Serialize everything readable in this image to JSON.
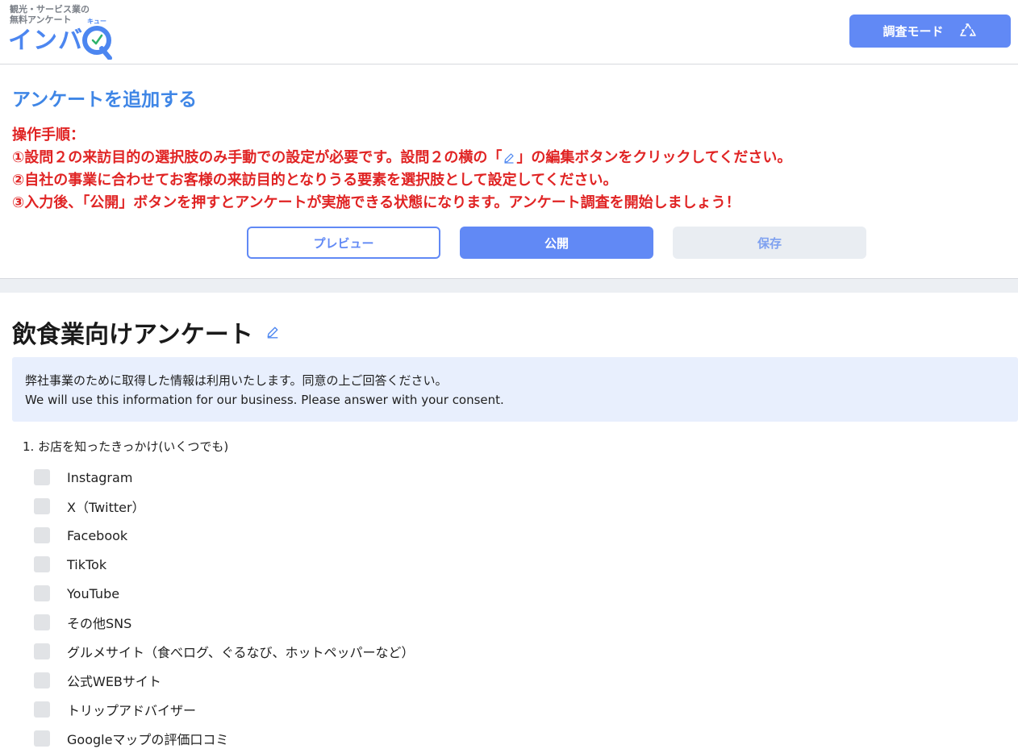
{
  "header": {
    "logo_tagline_line1": "観光・サービス業の",
    "logo_tagline_line2": "無料アンケート",
    "logo_brand": "インバ",
    "logo_q_ruby": "キュー",
    "mode_button_label": "調査モード"
  },
  "instructions": {
    "title": "アンケートを追加する",
    "heading": "操作手順：",
    "step1_before": "①設問２の来訪目的の選択肢のみ手動での設定が必要です。設問２の横の「",
    "step1_after": "」の編集ボタンをクリックしてください。",
    "step2": "②自社の事業に合わせてお客様の来訪目的となりうる要素を選択肢として設定してください。",
    "step3": "③入力後、「公開」ボタンを押すとアンケートが実施できる状態になります。アンケート調査を開始しましょう！"
  },
  "actions": {
    "preview_label": "プレビュー",
    "publish_label": "公開",
    "save_label": "保存"
  },
  "survey": {
    "title": "飲食業向けアンケート",
    "notice_line1": "弊社事業のために取得した情報は利用いたします。同意の上ご回答ください。",
    "notice_line2": "We will use this information for our business. Please answer with your consent.",
    "question1": {
      "label": "1. お店を知ったきっかけ(いくつでも)",
      "options": [
        "Instagram",
        "X（Twitter）",
        "Facebook",
        "TikTok",
        "YouTube",
        "その他SNS",
        "グルメサイト（食べログ、ぐるなび、ホットペッパーなど）",
        "公式WEBサイト",
        "トリップアドバイザー",
        "Googleマップの評価口コミ"
      ]
    }
  },
  "colors": {
    "accent": "#6189f5",
    "title_blue": "#3f86e6",
    "instruction_red": "#e02424",
    "notice_bg": "#e8effd"
  },
  "icons": {
    "mode_button": "recycle-icon",
    "edit": "pencil-icon",
    "logo_check": "check-icon"
  }
}
